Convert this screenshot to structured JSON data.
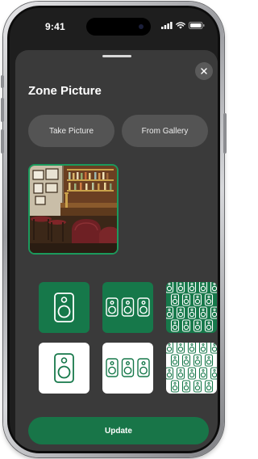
{
  "status_bar": {
    "time": "9:41",
    "icons": [
      "cellular-signal-icon",
      "wifi-icon",
      "battery-icon"
    ]
  },
  "sheet": {
    "title": "Zone Picture",
    "close_icon": "close-icon",
    "take_picture_label": "Take Picture",
    "from_gallery_label": "From Gallery",
    "selected_image": "bar-interior-photo",
    "update_label": "Update"
  },
  "pattern_tiles": [
    {
      "pattern": "single-speaker",
      "variant": "green-background"
    },
    {
      "pattern": "three-speakers",
      "variant": "green-background"
    },
    {
      "pattern": "speaker-grid",
      "variant": "green-background"
    },
    {
      "pattern": "single-speaker",
      "variant": "white-background"
    },
    {
      "pattern": "three-speakers",
      "variant": "white-background"
    },
    {
      "pattern": "speaker-grid",
      "variant": "white-background"
    }
  ],
  "colors": {
    "accent_green": "#187548",
    "tile_green": "#16784a",
    "sheet_background": "#3a3a3a",
    "button_background": "#545454"
  }
}
